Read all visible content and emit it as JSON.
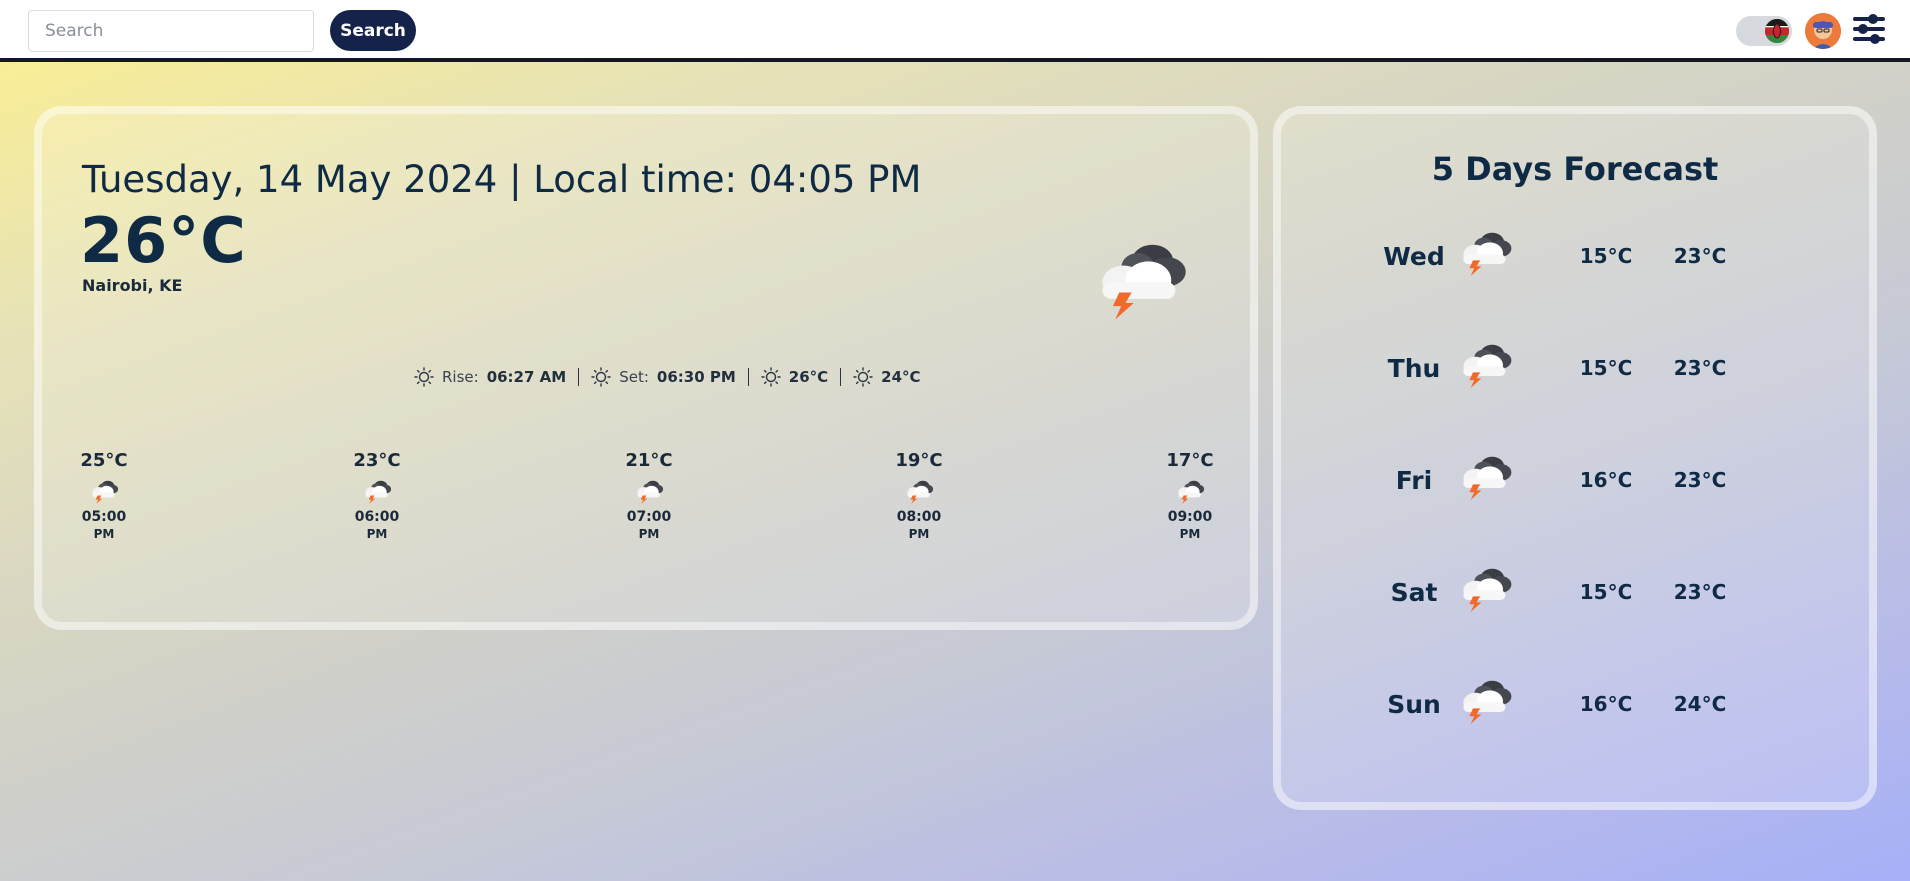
{
  "header": {
    "search_placeholder": "Search",
    "search_button": "Search"
  },
  "current": {
    "date_line": "Tuesday, 14 May 2024 | Local time: 04:05 PM",
    "temp": "26°C",
    "location": "Nairobi, KE",
    "icon": "thunderstorm-icon",
    "details": {
      "rise_label": "Rise:",
      "rise_value": "06:27 AM",
      "set_label": "Set:",
      "set_value": "06:30 PM",
      "high": "26°C",
      "low": "24°C"
    }
  },
  "hourly": [
    {
      "temp": "25°C",
      "time": "05:00",
      "ampm": "PM"
    },
    {
      "temp": "23°C",
      "time": "06:00",
      "ampm": "PM"
    },
    {
      "temp": "21°C",
      "time": "07:00",
      "ampm": "PM"
    },
    {
      "temp": "19°C",
      "time": "08:00",
      "ampm": "PM"
    },
    {
      "temp": "17°C",
      "time": "09:00",
      "ampm": "PM"
    }
  ],
  "forecast": {
    "title": "5 Days Forecast",
    "days": [
      {
        "day": "Wed",
        "min": "15°C",
        "max": "23°C"
      },
      {
        "day": "Thu",
        "min": "15°C",
        "max": "23°C"
      },
      {
        "day": "Fri",
        "min": "16°C",
        "max": "23°C"
      },
      {
        "day": "Sat",
        "min": "15°C",
        "max": "23°C"
      },
      {
        "day": "Sun",
        "min": "16°C",
        "max": "24°C"
      }
    ]
  },
  "colors": {
    "primary_text": "#0f2a44",
    "button_bg": "#15234a",
    "lightning": "#f06a2c"
  }
}
